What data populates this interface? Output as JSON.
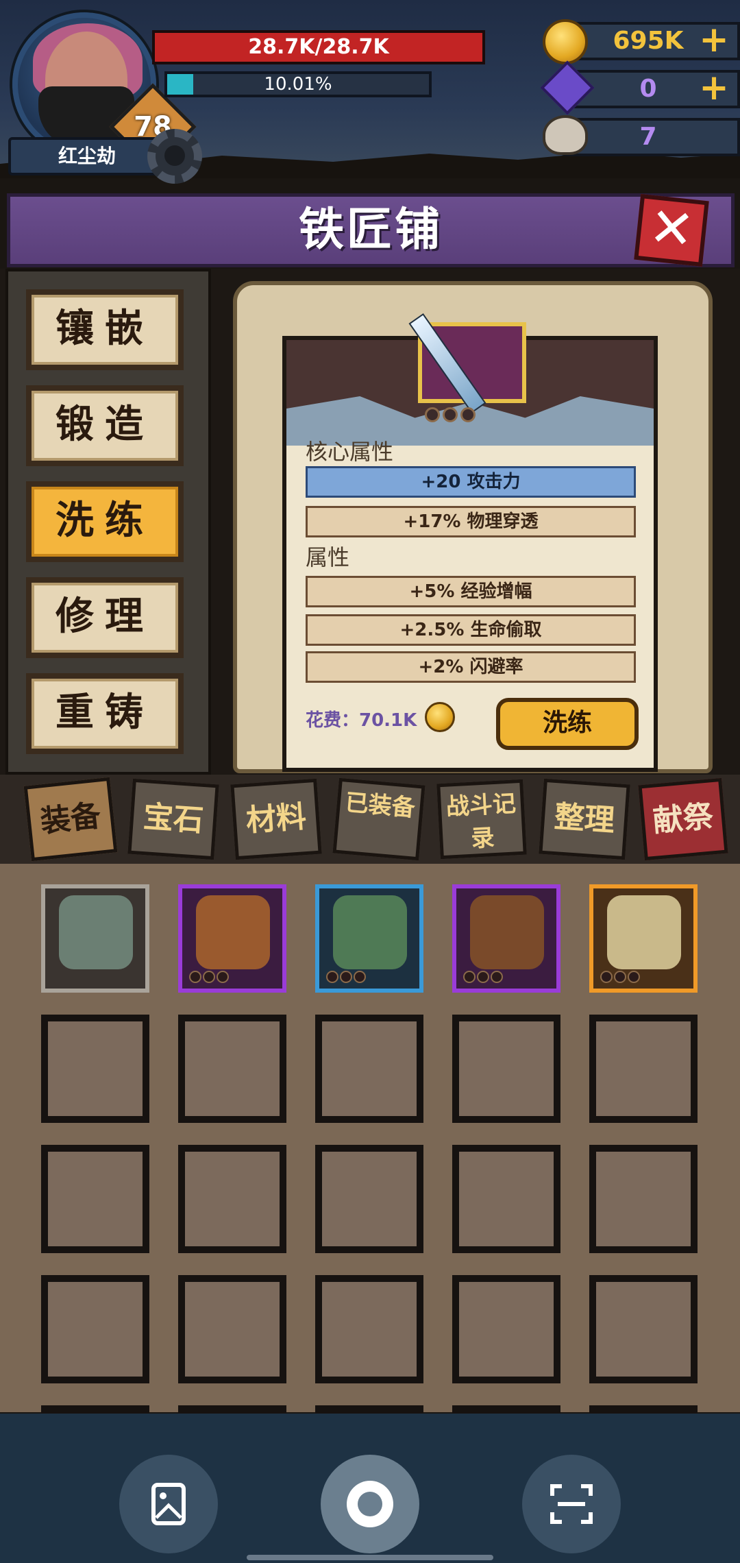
{
  "hud": {
    "player_name": "红尘劫",
    "level": "78",
    "hp_text": "28.7K/28.7K",
    "xp_text": "10.01%",
    "xp_fraction": 0.1001,
    "gold": "695K",
    "crystal": "0",
    "skull": "7",
    "plus": "+"
  },
  "banner": {
    "title": "铁匠铺",
    "close": "✕"
  },
  "sidebar": {
    "items": [
      {
        "label": "镶嵌",
        "active": false
      },
      {
        "label": "锻造",
        "active": false
      },
      {
        "label": "洗练",
        "active": true
      },
      {
        "label": "修理",
        "active": false
      },
      {
        "label": "重铸",
        "active": false
      }
    ]
  },
  "item_detail": {
    "core_label": "核心属性",
    "core_stats": [
      "+20 攻击力",
      "+17% 物理穿透"
    ],
    "attr_label": "属性",
    "attr_stats": [
      "+5% 经验增幅",
      "+2.5% 生命偷取",
      "+2% 闪避率"
    ],
    "cost_text": "花费：70.1K",
    "refine_button": "洗练"
  },
  "tabs": [
    {
      "label": "装备",
      "style": "active"
    },
    {
      "label": "宝石",
      "style": "normal"
    },
    {
      "label": "材料",
      "style": "normal"
    },
    {
      "label": "已装备",
      "style": "normal"
    },
    {
      "label": "战斗记录",
      "style": "normal"
    },
    {
      "label": "整理",
      "style": "normal"
    },
    {
      "label": "献祭",
      "style": "red"
    }
  ],
  "inventory": [
    {
      "name": "pants-icon",
      "rarity": "white",
      "color": "#6b7f73"
    },
    {
      "name": "helmet-icon",
      "rarity": "purple",
      "color": "#9a5a2e"
    },
    {
      "name": "boots-icon",
      "rarity": "blue",
      "color": "#4f7a55"
    },
    {
      "name": "belt-icon",
      "rarity": "purple",
      "color": "#7a4a2a"
    },
    {
      "name": "sword-icon",
      "rarity": "orange",
      "color": "#c9b98a"
    }
  ],
  "system_bar": {
    "buttons": [
      "gallery-icon",
      "record-icon",
      "scan-icon"
    ]
  }
}
